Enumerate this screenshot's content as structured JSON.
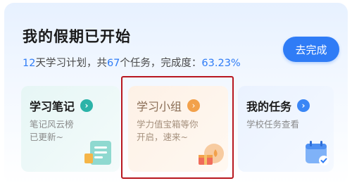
{
  "header": {
    "title": "我的假期已开始",
    "summary": {
      "days": "12",
      "days_suffix": "天学习计划，共",
      "tasks": "67",
      "tasks_suffix": "个任务，完成度：",
      "completion": "63.23%"
    },
    "go_button": "去完成"
  },
  "tiles": [
    {
      "title": "学习笔记",
      "desc": "笔记风云榜\n已更新~",
      "accent": "#2bb3a8"
    },
    {
      "title": "学习小组",
      "desc": "学力值宝箱等你\n开启，速来~",
      "accent": "#f2a14b"
    },
    {
      "title": "我的任务",
      "desc": "学校任务查看",
      "accent": "#3a86f5"
    }
  ],
  "colors": {
    "primary": "#2f7cf6",
    "highlight_border": "#b8171f"
  },
  "icons": [
    "chevron-right-icon",
    "notebook-icon",
    "treasure-box-icon",
    "calendar-check-icon"
  ]
}
